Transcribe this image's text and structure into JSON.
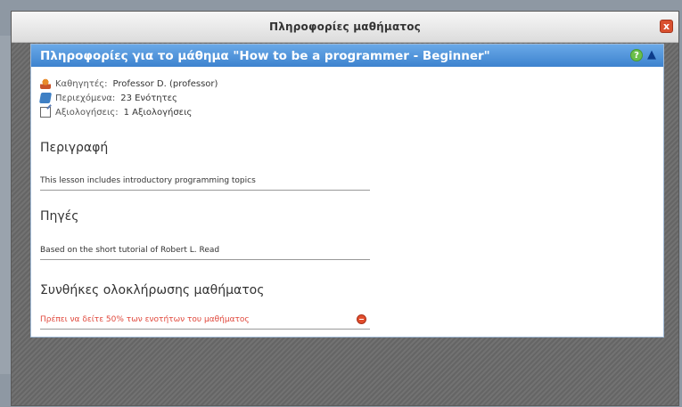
{
  "modal": {
    "title": "Πληροφορίες μαθήματος",
    "close_label": "x"
  },
  "panel": {
    "title": "Πληροφορίες για το μάθημα \"How to be a programmer - Beginner\"",
    "help_label": "?",
    "collapse_label": "▲"
  },
  "meta": [
    {
      "icon": "person-icon",
      "label": "Καθηγητές:",
      "value": "Professor D. (professor)"
    },
    {
      "icon": "book-icon",
      "label": "Περιεχόμενα:",
      "value": "23 Ενότητες"
    },
    {
      "icon": "edit-icon",
      "label": "Αξιολογήσεις:",
      "value": "1 Αξιολογήσεις"
    }
  ],
  "sections": {
    "description": {
      "title": "Περιγραφή",
      "text": "This lesson includes introductory programming topics"
    },
    "sources": {
      "title": "Πηγές",
      "text": "Based on the short tutorial of Robert L. Read"
    },
    "completion": {
      "title": "Συνθήκες ολοκλήρωσης μαθήματος",
      "text": "Πρέπει να δείτε 50% των ενοτήτων του μαθήματος"
    }
  },
  "colors": {
    "header": "#3d83cf",
    "warning": "#e0483c",
    "close": "#d9502f"
  }
}
